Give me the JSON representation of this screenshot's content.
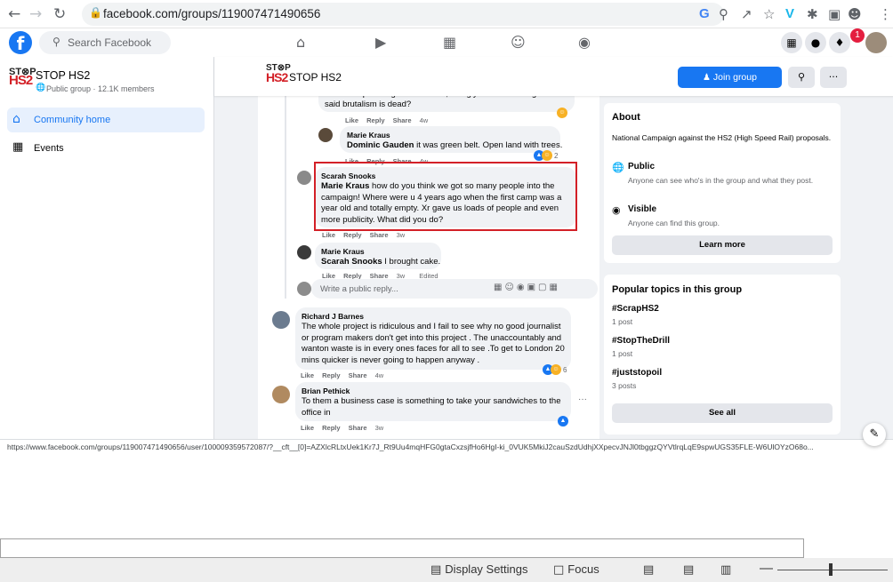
{
  "browser": {
    "url": "facebook.com/groups/119007471490656",
    "back_icon": "arrow-left",
    "forward_icon": "arrow-right",
    "reload_icon": "reload",
    "lock_icon": "lock"
  },
  "fb": {
    "logo": "f",
    "search_placeholder": "Search Facebook",
    "notification_count": "1"
  },
  "group": {
    "logo_line1": "ST⊗P",
    "logo_line2": "HS2",
    "name": "STOP HS2",
    "meta": "Public group · 12.1K members",
    "nav": [
      {
        "label": "Community home"
      },
      {
        "label": "Events"
      }
    ],
    "join_label": "Join group",
    "more_label": "···"
  },
  "feed": {
    "c0_text_partial": "bet it was prime agricultural land, so ugly the whole thing. Who",
    "c0_text_line2": "said brutalism is dead?",
    "c0_time": "4w",
    "c1_author": "Marie Kraus",
    "c1_mention": "Dominic Gauden",
    "c1_text": " it was green belt. Open land with trees.",
    "c1_time": "4w",
    "c1_reacts": "2",
    "c2_author": "Scarah Snooks",
    "c2_mention": "Marie Kraus",
    "c2_text": " how do you think we got so many people into the campaign! Where were u 4 years ago when the first camp was a year old and totally empty. Xr gave us loads of people and even more publicity. What did you do?",
    "c2_time": "3w",
    "c3_author": "Marie Kraus",
    "c3_mention": "Scarah Snooks",
    "c3_text": " I brought cake.",
    "c3_time": "3w",
    "c3_edited": "Edited",
    "reply_placeholder": "Write a public reply...",
    "c4_author": "Richard J Barnes",
    "c4_text": "The whole project is ridiculous and I fail to see why no good journalist or program makers don't get into this project . The unaccountably and wanton waste is in every ones faces for all to see .To get to London 20 mins quicker is never going to happen anyway .",
    "c4_time": "4w",
    "c4_reacts": "6",
    "c5_author": "Brian Pethick",
    "c5_text": "To them a business case is something to take your sandwiches to the office in",
    "c5_time": "3w",
    "like": "Like",
    "reply": "Reply",
    "share": "Share"
  },
  "about": {
    "title": "About",
    "description": "National Campaign against the HS2 (High Speed Rail) proposals.",
    "public_title": "Public",
    "public_desc": "Anyone can see who's in the group and what they post.",
    "visible_title": "Visible",
    "visible_desc": "Anyone can find this group.",
    "learn_more": "Learn more"
  },
  "topics": {
    "title": "Popular topics in this group",
    "items": [
      {
        "tag": "#ScrapHS2",
        "count": "1 post"
      },
      {
        "tag": "#StopTheDrill",
        "count": "1 post"
      },
      {
        "tag": "#juststopoil",
        "count": "3 posts"
      }
    ],
    "see_all": "See all"
  },
  "status_url": "https://www.facebook.com/groups/119007471490656/user/100009359572087/?__cft__[0]=AZXlcRLtxUek1Kr7J_Rt9Uu4mqHFG0gtaCxzsjfHo6HgI-ki_0VUK5MkiJ2cauSzdUdhjXXpecvJNJl0tbggzQYVtlrqLqE9spwUGS35FLE-W6UlOYzO68o...",
  "reader_bar": {
    "display_settings": "Display Settings",
    "focus": "Focus",
    "zoom_minus": "—"
  },
  "colors": {
    "fb_blue": "#1877f2",
    "highlight_red": "#d32027",
    "notification_red": "#e41e3f"
  }
}
